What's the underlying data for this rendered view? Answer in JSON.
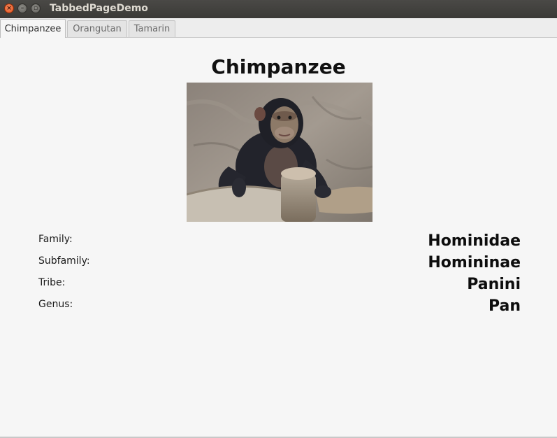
{
  "window": {
    "title": "TabbedPageDemo",
    "close_glyph": "×",
    "minimize_glyph": "–",
    "maximize_glyph": "▫"
  },
  "tabs": [
    {
      "label": "Chimpanzee",
      "active": true
    },
    {
      "label": "Orangutan",
      "active": false
    },
    {
      "label": "Tamarin",
      "active": false
    }
  ],
  "page": {
    "title": "Chimpanzee",
    "image_subject": "chimpanzee-photo",
    "details": [
      {
        "label": "Family:",
        "value": "Hominidae"
      },
      {
        "label": "Subfamily:",
        "value": "Homininae"
      },
      {
        "label": "Tribe:",
        "value": "Panini"
      },
      {
        "label": "Genus:",
        "value": "Pan"
      }
    ]
  },
  "colors": {
    "close_button": "#e2541f",
    "titlebar": "#3b3a37",
    "background": "#f6f6f6"
  }
}
